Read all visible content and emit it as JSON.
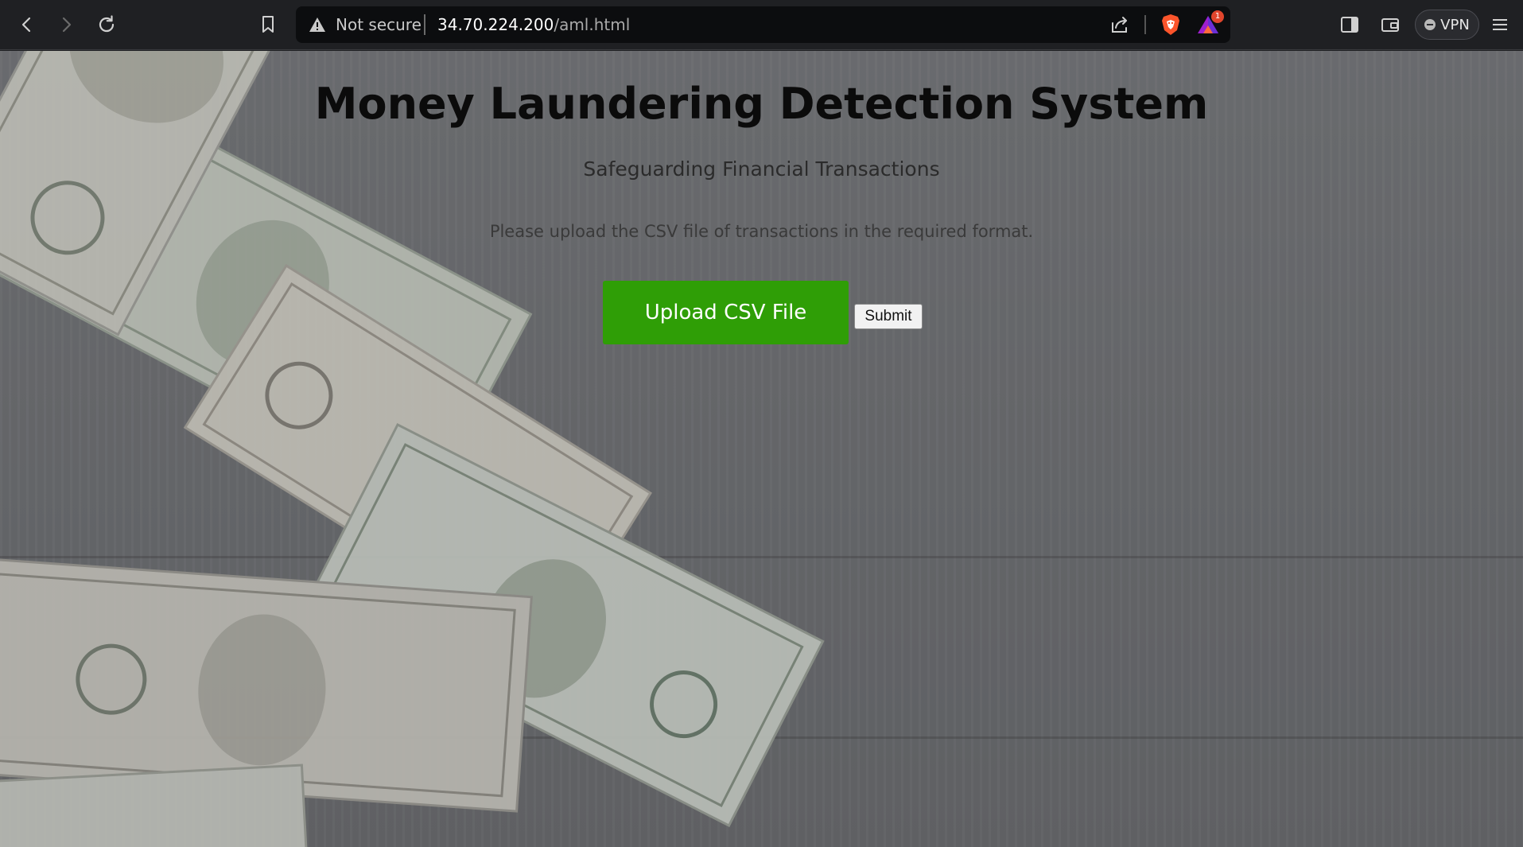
{
  "browser": {
    "url_status": "Not secure",
    "url_host": "34.70.224.200",
    "url_path": "/aml.html",
    "rewards_badge_count": "1",
    "vpn_label": "VPN"
  },
  "page": {
    "title": "Money Laundering Detection System",
    "subtitle": "Safeguarding Financial Transactions",
    "instructions": "Please upload the CSV file of transactions in the required format.",
    "upload_label": "Upload CSV File",
    "submit_label": "Submit"
  },
  "colors": {
    "upload_button": "#2f9e06",
    "toolbar": "#1f2023"
  }
}
